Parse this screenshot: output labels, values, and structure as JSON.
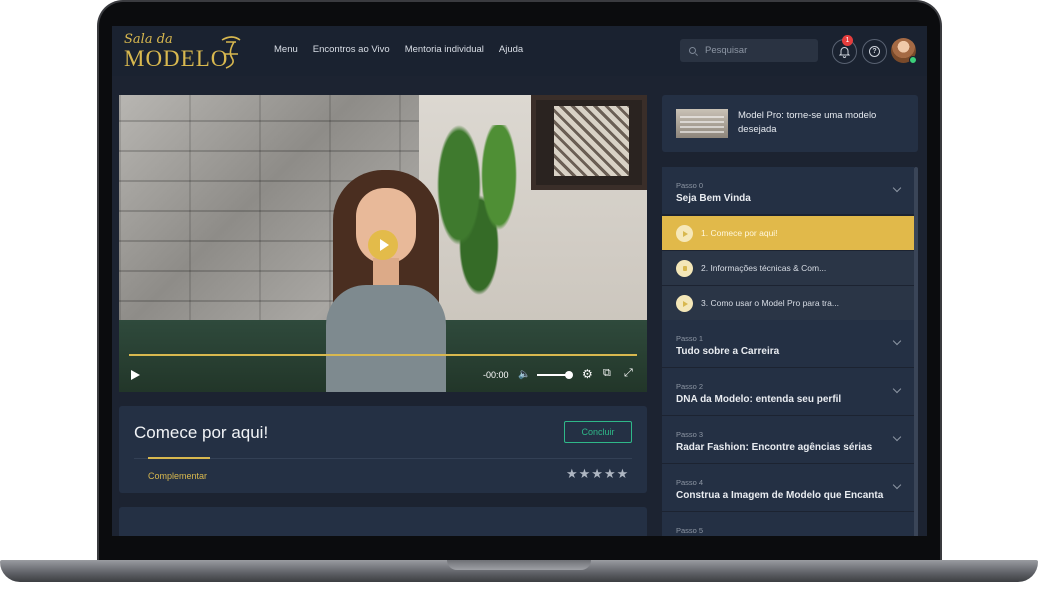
{
  "logo": {
    "line1": "Sala da",
    "line2": "MODELO"
  },
  "nav": {
    "items": [
      "Menu",
      "Encontros ao Vivo",
      "Mentoria individual",
      "Ajuda"
    ]
  },
  "search": {
    "placeholder": "Pesquisar"
  },
  "notifications": {
    "count": "1"
  },
  "video": {
    "time": "-00:00",
    "progress": 1.0,
    "volume": 1.0
  },
  "lesson": {
    "title": "Comece por aqui!",
    "conclude_label": "Concluir",
    "tab_label": "Complementar",
    "rating_stars": "★★★★★"
  },
  "course": {
    "title": "Model Pro: torne-se uma modelo desejada"
  },
  "steps": [
    {
      "num": "Passo 0",
      "name": "Seja Bem Vinda",
      "expanded": true,
      "lessons": [
        {
          "label": "1. Comece por aqui!",
          "active": true,
          "type": "video"
        },
        {
          "label": "2. Informações técnicas & Com...",
          "active": false,
          "type": "doc"
        },
        {
          "label": "3. Como usar o Model Pro para tra...",
          "active": false,
          "type": "video"
        }
      ]
    },
    {
      "num": "Passo 1",
      "name": "Tudo sobre a Carreira"
    },
    {
      "num": "Passo 2",
      "name": "DNA da Modelo: entenda seu perfil"
    },
    {
      "num": "Passo 3",
      "name": "Radar Fashion: Encontre agências sérias"
    },
    {
      "num": "Passo 4",
      "name": "Construa a Imagem de Modelo que Encanta"
    },
    {
      "num": "Passo 5",
      "name": ""
    }
  ],
  "colors": {
    "accent": "#d8b84f",
    "bg": "#1c2331",
    "card": "#243044",
    "success": "#2fb889"
  }
}
